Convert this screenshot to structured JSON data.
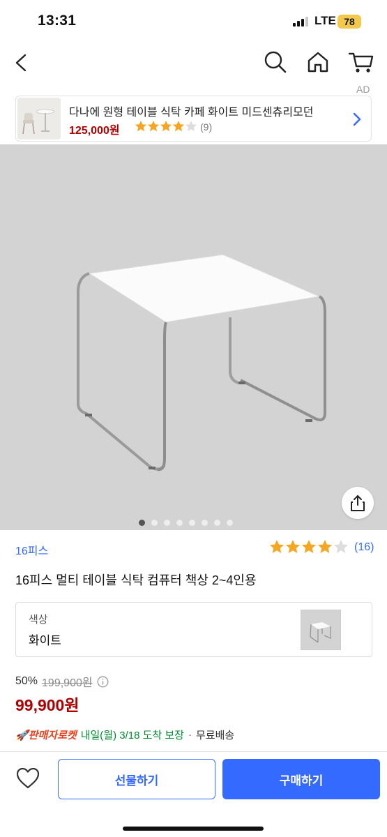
{
  "status_bar": {
    "time": "13:31",
    "network": "LTE",
    "battery": "78"
  },
  "nav": {
    "back_icon": "chevron-left-icon",
    "search_icon": "search-icon",
    "home_icon": "home-icon",
    "cart_icon": "cart-icon"
  },
  "ad": {
    "label": "AD",
    "title": "다나에 원형 테이블 식탁 카페 화이트 미드센츄리모던",
    "price": "125,000원",
    "rating": 4.5,
    "review_count": "(9)"
  },
  "gallery": {
    "image_count": 8,
    "active_index": 0
  },
  "product": {
    "brand": "16피스",
    "rating": 4.5,
    "review_count": "(16)",
    "title": "16피스 멀티 테이블 식탁 컴퓨터 책상 2~4인용"
  },
  "option": {
    "label": "색상",
    "value": "화이트"
  },
  "pricing": {
    "discount": "50%",
    "original_price": "199,900원",
    "sale_price": "99,900원"
  },
  "delivery": {
    "badge": "🚀판매자로켓",
    "date": "내일(월) 3/18 도착 보장",
    "separator": "·",
    "shipping": "무료배송"
  },
  "actions": {
    "gift": "선물하기",
    "buy": "구매하기"
  },
  "colors": {
    "accent": "#346aff",
    "price": "#ae0000",
    "star": "#f5a623",
    "delivery": "#008b2f"
  }
}
